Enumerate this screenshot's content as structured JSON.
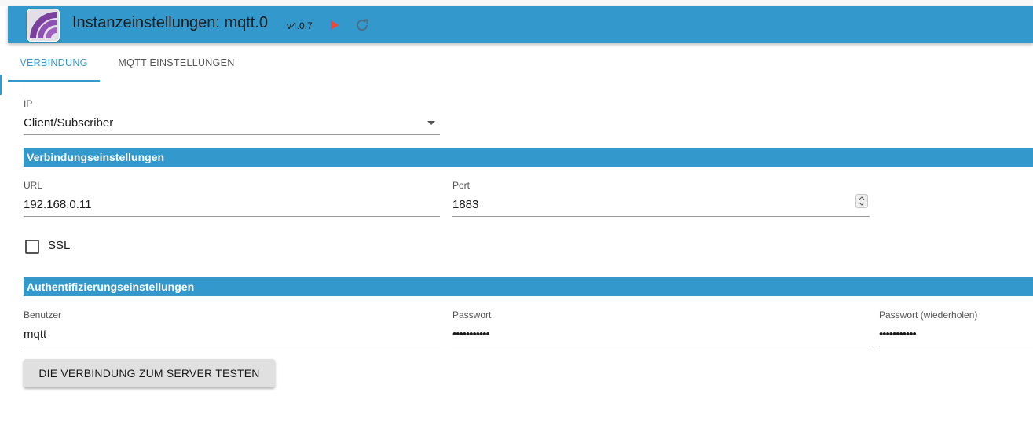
{
  "header": {
    "title": "Instanzeinstellungen: mqtt.0",
    "version": "v4.0.7",
    "play_icon": "play-icon",
    "reload_icon": "reload-icon",
    "play_color": "#f44336",
    "bar_color": "#3399cc"
  },
  "tabs": [
    {
      "label": "VERBINDUNG",
      "active": true
    },
    {
      "label": "MQTT EINSTELLUNGEN",
      "active": false
    }
  ],
  "ip": {
    "label": "IP",
    "value": "Client/Subscriber"
  },
  "connection": {
    "section_title": "Verbindungseinstellungen",
    "url_label": "URL",
    "url_value": "192.168.0.11",
    "port_label": "Port",
    "port_value": "1883",
    "ssl_label": "SSL",
    "ssl_checked": false
  },
  "auth": {
    "section_title": "Authentifizierungseinstellungen",
    "user_label": "Benutzer",
    "user_value": "mqtt",
    "password_label": "Passwort",
    "password_value": "•••••••••••",
    "password_repeat_label": "Passwort (wiederholen)",
    "password_repeat_value": "•••••••••••"
  },
  "test_button_label": "DIE VERBINDUNG ZUM SERVER TESTEN"
}
